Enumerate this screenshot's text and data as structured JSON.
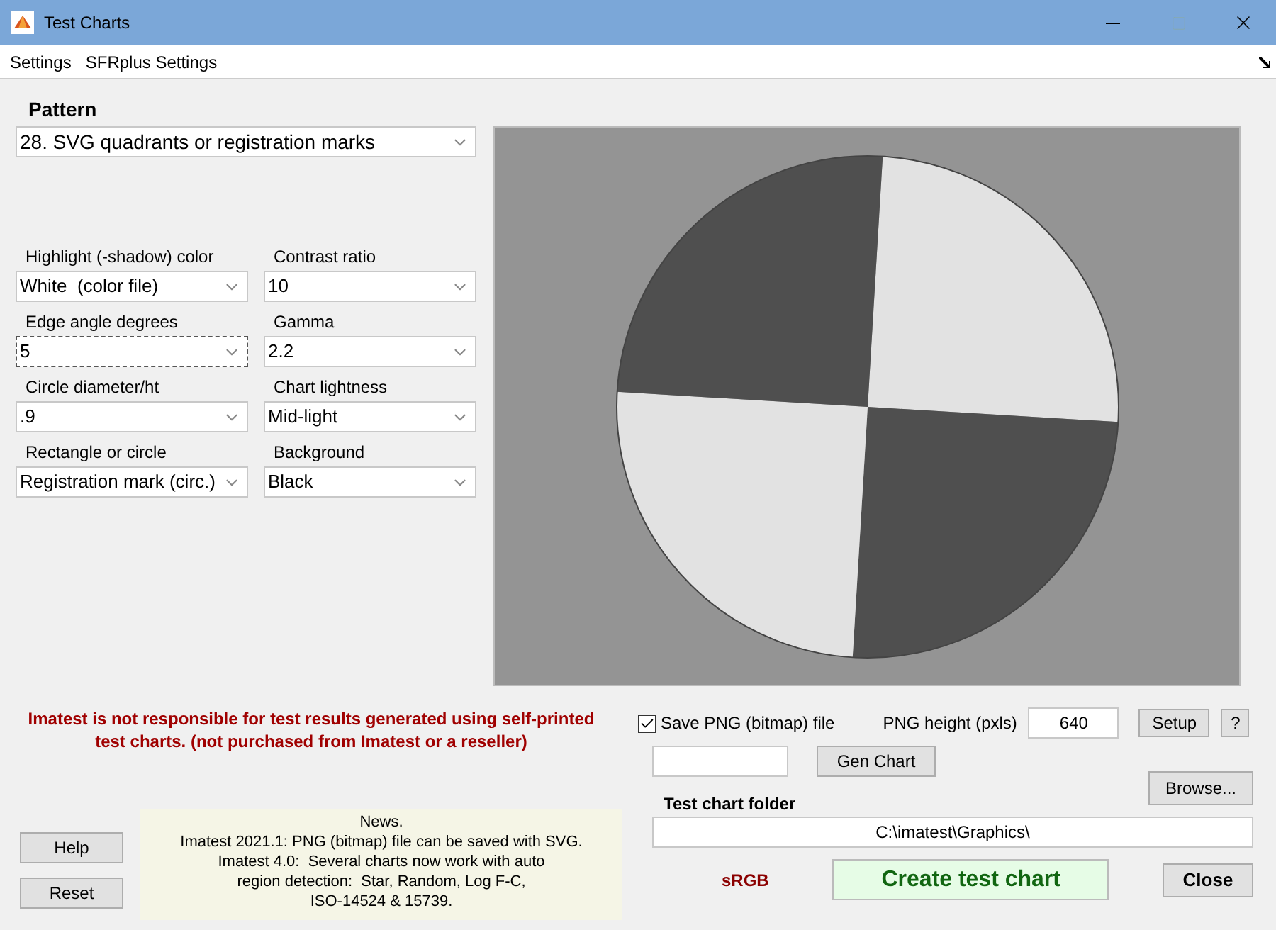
{
  "window": {
    "title": "Test Charts"
  },
  "menu": [
    "Settings",
    "SFRplus Settings"
  ],
  "pattern": {
    "label": "Pattern",
    "value": "28. SVG quadrants or registration marks"
  },
  "fields": [
    {
      "label": "Highlight (-shadow) color",
      "value": "White  (color file)",
      "focused": false
    },
    {
      "label": "Contrast ratio",
      "value": "10",
      "focused": false
    },
    {
      "label": "Edge angle degrees",
      "value": "5",
      "focused": true
    },
    {
      "label": "Gamma",
      "value": "2.2",
      "focused": false
    },
    {
      "label": "Circle diameter/ht",
      "value": ".9",
      "focused": false
    },
    {
      "label": "Chart lightness",
      "value": "Mid-light",
      "focused": false
    },
    {
      "label": "Rectangle or circle",
      "value": "Registration mark (circ.)",
      "focused": false
    },
    {
      "label": "Background",
      "value": "Black",
      "focused": false
    }
  ],
  "warning": "Imatest is not responsible for test results generated using self-printed test charts. (not purchased from Imatest or a reseller)",
  "save_png": {
    "label": "Save PNG (bitmap) file",
    "checked": true
  },
  "png_height": {
    "label": "PNG height (pxls)",
    "value": "640"
  },
  "setup_button": "Setup",
  "help_small_button": "?",
  "gen_chart": {
    "button": "Gen Chart"
  },
  "browse_button": "Browse...",
  "folder": {
    "label": "Test chart folder",
    "value": "C:\\imatest\\Graphics\\"
  },
  "news": [
    "News.",
    "Imatest 2021.1: PNG (bitmap) file can be saved with SVG.",
    "Imatest 4.0:  Several charts now work with auto",
    "region detection:  Star, Random, Log F-C,",
    "ISO-14524 & 15739."
  ],
  "help_button": "Help",
  "reset_button": "Reset",
  "color_space": "sRGB",
  "create_button": "Create test chart",
  "close_button": "Close"
}
